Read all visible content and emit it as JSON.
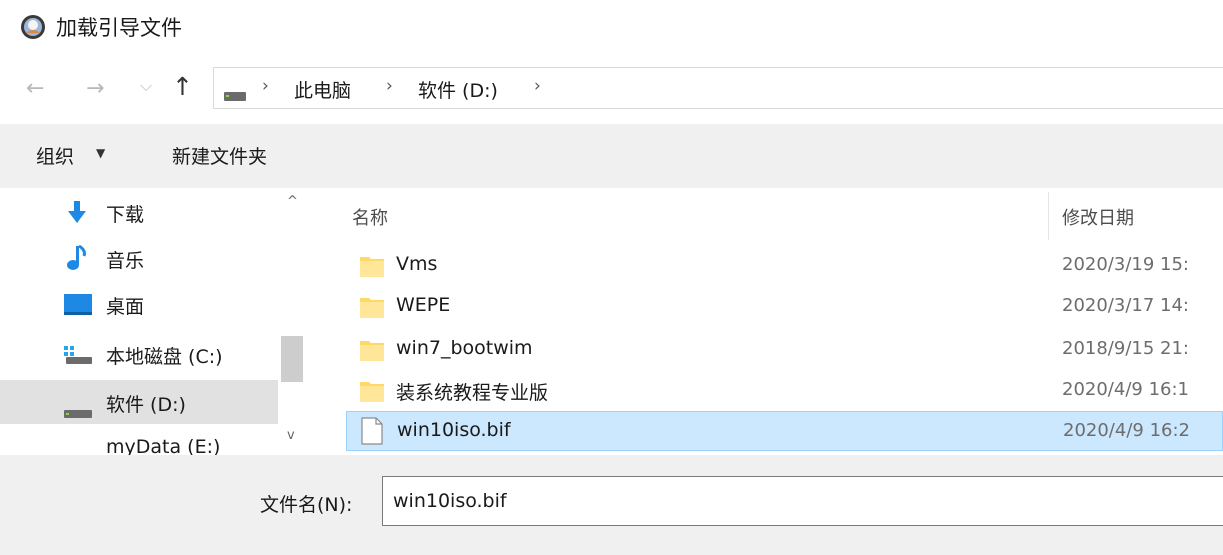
{
  "window": {
    "title": "加载引导文件"
  },
  "nav": {
    "back_glyph": "←",
    "forward_glyph": "→",
    "recent_glyph": "⌵",
    "up_glyph": "↑",
    "crumbs": [
      "此电脑",
      "软件 (D:)"
    ],
    "crumb_sep": "›"
  },
  "toolbar": {
    "organize": "组织",
    "organize_caret": "▼",
    "new_folder": "新建文件夹"
  },
  "sidebar": {
    "items": [
      {
        "label": "下载",
        "icon": "download-icon"
      },
      {
        "label": "音乐",
        "icon": "music-icon"
      },
      {
        "label": "桌面",
        "icon": "desktop-icon"
      },
      {
        "label": "本地磁盘 (C:)",
        "icon": "local-disk-icon"
      },
      {
        "label": "软件 (D:)",
        "icon": "drive-icon",
        "selected": true
      },
      {
        "label": "myData (E:)",
        "icon": "drive-icon"
      }
    ],
    "scroll_up": "^",
    "scroll_down": "v"
  },
  "filelist": {
    "sort_indicator": "^",
    "columns": {
      "name": "名称",
      "date": "修改日期"
    },
    "rows": [
      {
        "name": "Vms",
        "date": "2020/3/19 15:",
        "type": "folder"
      },
      {
        "name": "WEPE",
        "date": "2020/3/17 14:",
        "type": "folder"
      },
      {
        "name": "win7_bootwim",
        "date": "2018/9/15 21:",
        "type": "folder"
      },
      {
        "name": "装系统教程专业版",
        "date": "2020/4/9 16:1",
        "type": "folder"
      },
      {
        "name": "win10iso.bif",
        "date": "2020/4/9 16:2",
        "type": "file",
        "selected": true
      }
    ]
  },
  "footer": {
    "filename_label": "文件名(N):",
    "filename_value": "win10iso.bif"
  },
  "colors": {
    "toolbar_bg": "#f0f0f0",
    "selection_bg": "#cce8ff",
    "selection_border": "#99d1ff",
    "sidebar_selected_bg": "#e1e1e1",
    "folder_yellow": "#ffd966"
  }
}
